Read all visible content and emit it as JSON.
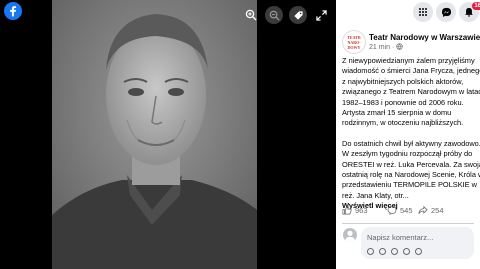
{
  "viewer": {
    "icons": [
      "facebook-logo",
      "zoom-in-icon",
      "zoom-out-icon",
      "tag-icon",
      "fullscreen-icon"
    ]
  },
  "topbar": {
    "notification_count": "16"
  },
  "post": {
    "page_name": "Teatr Narodowy w Warszawie",
    "avatar_text": [
      "TEATR",
      "NARO-",
      "DOWY"
    ],
    "time": "21 min · ",
    "paragraph1": "Z niewypowiedzianym żalem przyjęliśmy wiadomość o śmierci Jana Frycza, jednego z najwybitniejszych polskich aktorów, związanego z Teatrem Narodowym w latach 1982–1983 i ponownie od 2006 roku. Artysta zmarł 15 sierpnia w domu rodzinnym, w otoczeniu najbliższych.",
    "paragraph2": "Do ostatnich chwil był aktywny zawodowo. W zeszłym tygodniu rozpoczął próby do ORESTEI w reż. Luka Percevala. Za swoją ostatnią rolę na Narodowej Scenie, Króla w przedstawieniu TERMOPILE POLSKIE w reż. Jana Klaty, otr...",
    "see_more": "Wyświetl więcej"
  },
  "reactions": {
    "likes": "963",
    "comments": "545",
    "shares": "254"
  },
  "comment": {
    "placeholder": "Napisz komentarz..."
  }
}
